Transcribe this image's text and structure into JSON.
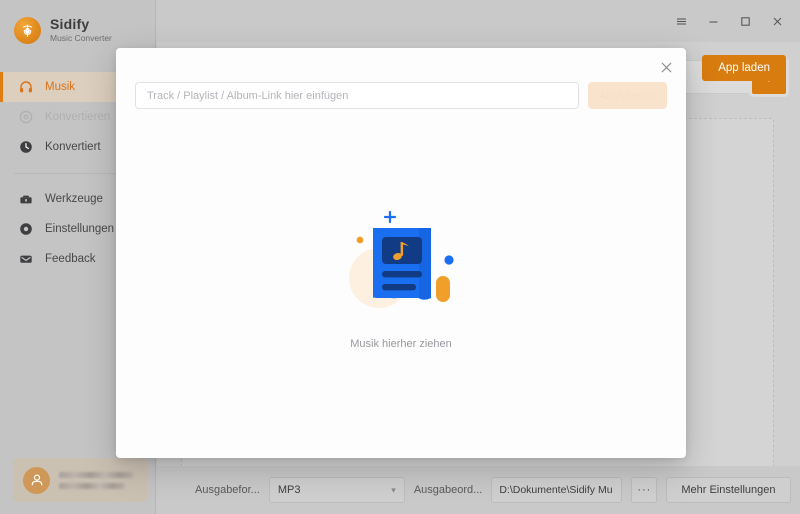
{
  "window": {
    "controls": [
      {
        "name": "menu",
        "label": "≡"
      },
      {
        "name": "minimize",
        "label": "−"
      },
      {
        "name": "maximize",
        "label": "□"
      },
      {
        "name": "close",
        "label": "✕"
      }
    ]
  },
  "brand": {
    "name": "Sidify",
    "tagline": "Music Converter",
    "logo_icon": "sidify-logo-icon",
    "logo_color": "#e08a1e"
  },
  "sidebar": {
    "items": [
      {
        "label": "Musik",
        "icon": "headphones-icon",
        "state": "active"
      },
      {
        "label": "Konvertieren",
        "icon": "convert-icon",
        "state": "disabled"
      },
      {
        "label": "Konvertiert",
        "icon": "clock-icon",
        "state": "normal"
      }
    ],
    "items2": [
      {
        "label": "Werkzeuge",
        "icon": "toolbox-icon",
        "state": "normal"
      },
      {
        "label": "Einstellungen",
        "icon": "gear-icon",
        "state": "normal"
      },
      {
        "label": "Feedback",
        "icon": "envelope-icon",
        "state": "normal"
      }
    ],
    "account": {
      "avatar_icon": "user-avatar-icon",
      "name": "",
      "email": ""
    },
    "active_color": "#d9741a",
    "accent_bar_color": "#e07c10"
  },
  "main": {
    "app_load_button": "App laden",
    "add_button": "+",
    "add_icon": "plus-icon"
  },
  "modal": {
    "close_icon": "close-icon",
    "input_placeholder": "Track / Playlist / Album-Link hier einfügen",
    "input_value": "",
    "analyze_button": "Analysieren",
    "drag_text": "Musik hierher ziehen",
    "illustration_icon": "music-document-illustration"
  },
  "bottombar": {
    "format_label": "Ausgabefor...",
    "format_value": "MP3",
    "format_chevron": "▾",
    "folder_label": "Ausgabeord...",
    "folder_value": "D:\\Dokumente\\Sidify Mu",
    "browse_button": "···",
    "more_settings_button": "Mehr Einstellungen"
  },
  "colors": {
    "accent": "#d97c10",
    "window_bg": "#c9c9c9",
    "sidebar_bg": "#c4c4c4",
    "modal_bg": "#fdfdfd",
    "illustration_blue": "#1b6ff0",
    "illustration_orange": "#f0a02a"
  }
}
